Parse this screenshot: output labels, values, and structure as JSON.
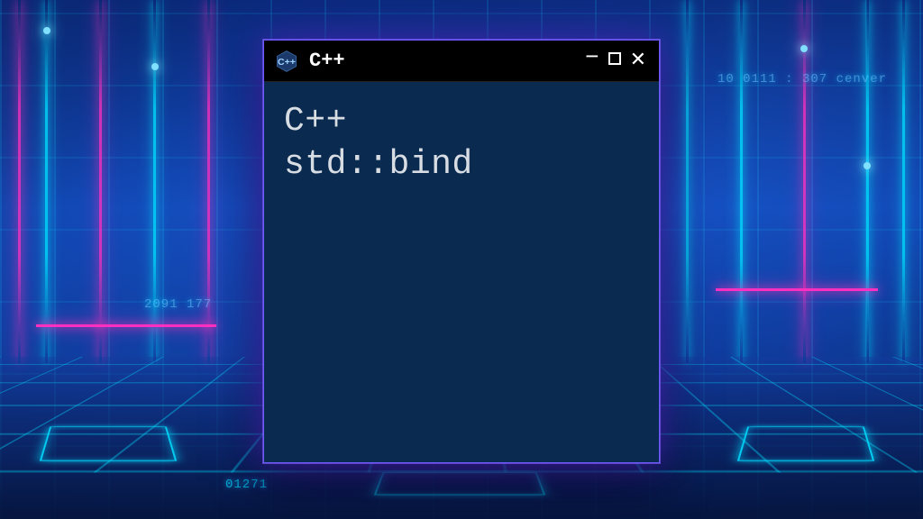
{
  "window": {
    "title": "C++",
    "icon_name": "cpp-hex-logo"
  },
  "content": {
    "line1": "C++",
    "line2": "std::bind"
  },
  "decoration": {
    "text1": "2091 177",
    "text2": "10 0111 : 307  cenver",
    "text3": "01271"
  }
}
